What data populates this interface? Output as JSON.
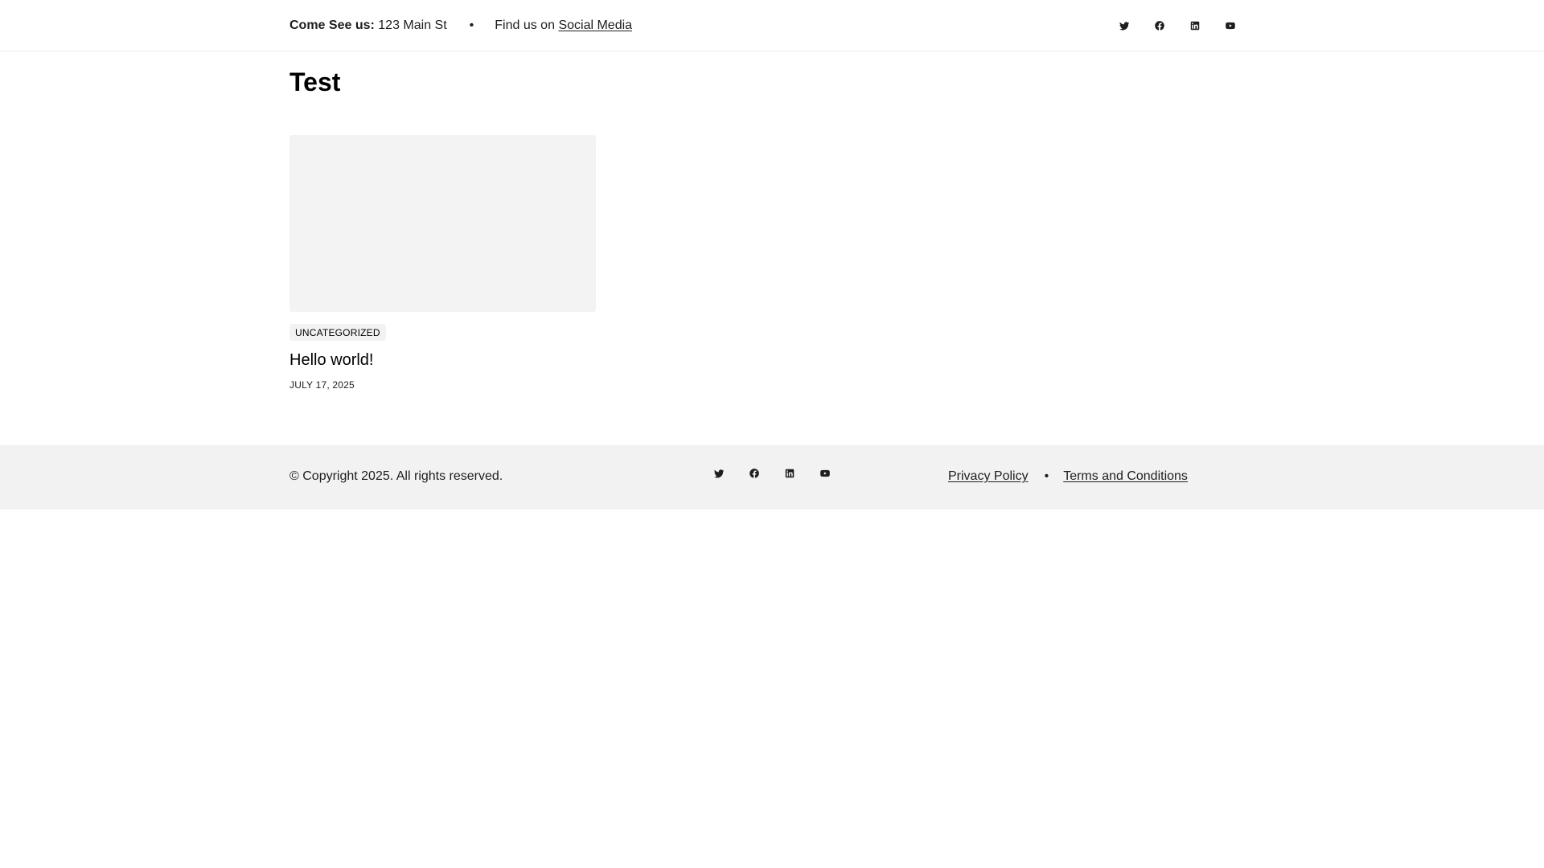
{
  "topbar": {
    "address_label": "Come See us:",
    "address_value": "123 Main St",
    "separator": "•",
    "find_us_text": "Find us on",
    "social_link_text": "Social Media",
    "social_icons": [
      "twitter-icon",
      "facebook-icon",
      "linkedin-icon",
      "youtube-icon"
    ]
  },
  "main": {
    "page_title": "Test",
    "posts": [
      {
        "category": "UNCATEGORIZED",
        "title": "Hello world!",
        "date": "JULY 17, 2025"
      }
    ]
  },
  "footer": {
    "copyright": "© Copyright 2025. All rights reserved.",
    "social_icons": [
      "twitter-icon",
      "facebook-icon",
      "linkedin-icon",
      "youtube-icon"
    ],
    "links": [
      "Privacy Policy",
      "Terms and Conditions"
    ],
    "separator": "•"
  },
  "colors": {
    "text": "#1e1e1e",
    "footer_bg": "#f2f2f2",
    "thumb_bg": "#f3f3f3",
    "border": "#ebebeb"
  }
}
